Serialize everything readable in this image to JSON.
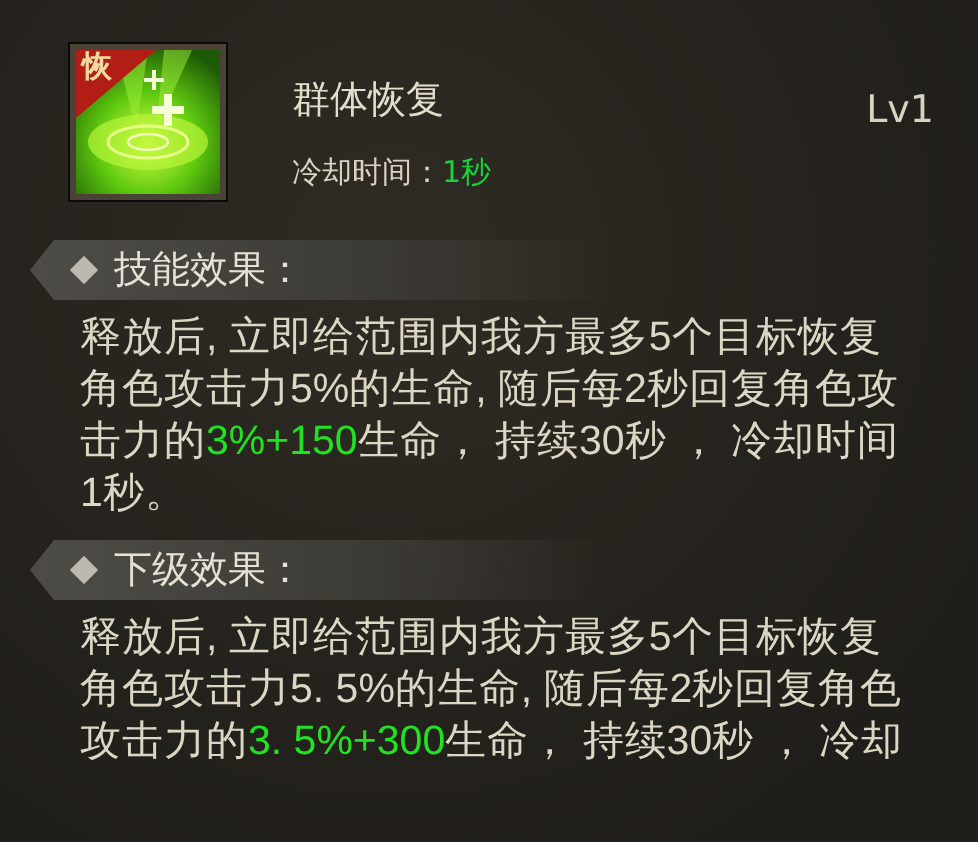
{
  "skill": {
    "icon_badge": "恢",
    "name": "群体恢复",
    "level": "Lv1",
    "cooldown_label": "冷却时间：",
    "cooldown_value": "1秒"
  },
  "sections": [
    {
      "title": "技能效果：",
      "text": [
        {
          "kind": "plain",
          "text": "释放后, 立即给范围内我方最多5个目标恢复角色攻击力5%的生命, 随后每2秒回复角色攻击力的"
        },
        {
          "kind": "highlight",
          "text": "3%+150"
        },
        {
          "kind": "plain",
          "text": "生命， 持续30秒 ， 冷却时间1秒。"
        }
      ]
    },
    {
      "title": "下级效果：",
      "text": [
        {
          "kind": "plain",
          "text": "释放后, 立即给范围内我方最多5个目标恢复角色攻击力5. 5%的生命, 随后每2秒回复角色攻击力的"
        },
        {
          "kind": "highlight",
          "text": "3. 5%+300"
        },
        {
          "kind": "plain",
          "text": "生命， 持续30秒 ， 冷却"
        }
      ]
    }
  ]
}
